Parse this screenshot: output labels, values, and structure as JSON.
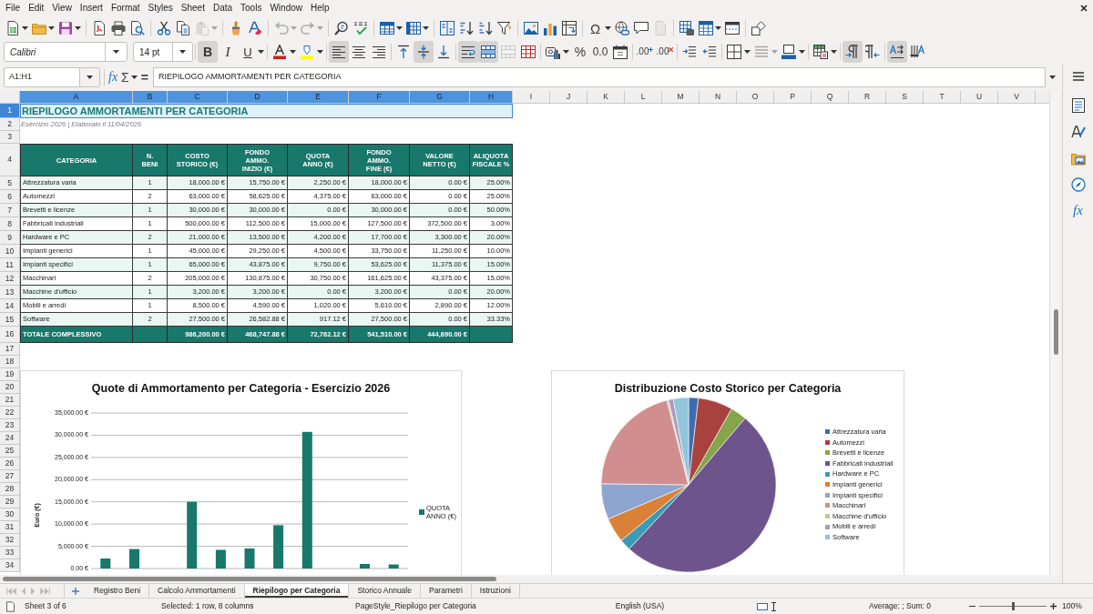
{
  "menu_bar": [
    "File",
    "Edit",
    "View",
    "Insert",
    "Format",
    "Styles",
    "Sheet",
    "Data",
    "Tools",
    "Window",
    "Help"
  ],
  "standard_toolbar": [
    {
      "kind": "icon",
      "dropdown": true,
      "disabled": false
    },
    {
      "kind": "icon",
      "dropdown": true,
      "disabled": false
    },
    {
      "kind": "icon",
      "dropdown": true,
      "disabled": false
    },
    {
      "kind": "separator"
    },
    {
      "kind": "icon",
      "dropdown": false,
      "disabled": false
    },
    {
      "kind": "icon",
      "dropdown": false,
      "disabled": false
    },
    {
      "kind": "icon",
      "dropdown": false,
      "disabled": false
    },
    {
      "kind": "separator"
    },
    {
      "kind": "icon",
      "dropdown": false,
      "disabled": false
    },
    {
      "kind": "icon",
      "dropdown": false,
      "disabled": false
    },
    {
      "kind": "icon",
      "dropdown": true,
      "disabled": true
    },
    {
      "kind": "separator"
    },
    {
      "kind": "icon",
      "dropdown": false,
      "disabled": false
    },
    {
      "kind": "icon",
      "dropdown": false,
      "disabled": false
    },
    {
      "kind": "separator"
    },
    {
      "kind": "icon",
      "dropdown": true,
      "disabled": true
    },
    {
      "kind": "icon",
      "dropdown": true,
      "disabled": true
    },
    {
      "kind": "separator"
    },
    {
      "kind": "icon",
      "dropdown": false,
      "disabled": false
    },
    {
      "kind": "icon",
      "dropdown": false,
      "disabled": false
    },
    {
      "kind": "separator"
    },
    {
      "kind": "icon",
      "dropdown": true,
      "disabled": false
    },
    {
      "kind": "icon",
      "dropdown": true,
      "disabled": false
    },
    {
      "kind": "separator"
    },
    {
      "kind": "icon",
      "dropdown": false,
      "disabled": false
    },
    {
      "kind": "icon",
      "dropdown": false,
      "disabled": false
    },
    {
      "kind": "icon",
      "dropdown": false,
      "disabled": false
    },
    {
      "kind": "icon",
      "dropdown": false,
      "disabled": false
    },
    {
      "kind": "separator"
    },
    {
      "kind": "icon",
      "dropdown": false,
      "disabled": false
    },
    {
      "kind": "icon",
      "dropdown": false,
      "disabled": false
    },
    {
      "kind": "icon",
      "dropdown": false,
      "disabled": false
    },
    {
      "kind": "separator"
    },
    {
      "kind": "glyph",
      "label": "Ω",
      "dropdown": true,
      "disabled": false
    },
    {
      "kind": "icon",
      "dropdown": false,
      "disabled": false
    },
    {
      "kind": "icon",
      "dropdown": false,
      "disabled": false
    },
    {
      "kind": "icon",
      "dropdown": false,
      "disabled": true
    },
    {
      "kind": "separator"
    },
    {
      "kind": "icon",
      "dropdown": false,
      "disabled": false
    },
    {
      "kind": "icon",
      "dropdown": true,
      "disabled": false
    },
    {
      "kind": "icon",
      "dropdown": false,
      "disabled": false
    },
    {
      "kind": "separator"
    },
    {
      "kind": "icon",
      "dropdown": false,
      "disabled": false
    }
  ],
  "formatting_toolbar": {
    "font_name": "Calibri",
    "font_size": "14 pt",
    "buttons": [
      {
        "kind": "separator"
      },
      {
        "kind": "glyph",
        "label": "B",
        "dropdown": false,
        "active": true,
        "disabled": false
      },
      {
        "kind": "glyph",
        "label": "I",
        "dropdown": false,
        "active": false,
        "disabled": false
      },
      {
        "kind": "glyph",
        "label": "U",
        "dropdown": true,
        "active": false,
        "disabled": false
      },
      {
        "kind": "separator"
      },
      {
        "kind": "icon",
        "dropdown": true,
        "active": false,
        "disabled": false
      },
      {
        "kind": "icon",
        "dropdown": true,
        "active": false,
        "disabled": false
      },
      {
        "kind": "separator"
      },
      {
        "kind": "icon",
        "dropdown": false,
        "active": true,
        "disabled": false
      },
      {
        "kind": "icon",
        "dropdown": false,
        "active": false,
        "disabled": false
      },
      {
        "kind": "icon",
        "dropdown": false,
        "active": false,
        "disabled": false
      },
      {
        "kind": "separator"
      },
      {
        "kind": "icon",
        "dropdown": false,
        "active": false,
        "disabled": false
      },
      {
        "kind": "icon",
        "dropdown": false,
        "active": true,
        "disabled": false
      },
      {
        "kind": "icon",
        "dropdown": false,
        "active": false,
        "disabled": false
      },
      {
        "kind": "separator"
      },
      {
        "kind": "icon",
        "dropdown": false,
        "active": true,
        "disabled": false
      },
      {
        "kind": "icon",
        "dropdown": false,
        "active": true,
        "disabled": false
      },
      {
        "kind": "icon",
        "dropdown": false,
        "active": false,
        "disabled": true
      },
      {
        "kind": "icon",
        "dropdown": false,
        "active": false,
        "disabled": false
      },
      {
        "kind": "separator"
      },
      {
        "kind": "icon",
        "dropdown": true,
        "active": false,
        "disabled": false
      },
      {
        "kind": "glyph",
        "label": "%",
        "dropdown": false,
        "active": false,
        "disabled": false
      },
      {
        "kind": "glyph",
        "label": "0.0",
        "dropdown": false,
        "active": false,
        "disabled": false
      },
      {
        "kind": "icon",
        "dropdown": false,
        "active": false,
        "disabled": false
      },
      {
        "kind": "separator"
      },
      {
        "kind": "glyph",
        "label": ".00",
        "dropdown": false,
        "active": false,
        "disabled": false
      },
      {
        "kind": "glyph",
        "label": ".00",
        "dropdown": false,
        "active": false,
        "disabled": false
      },
      {
        "kind": "separator"
      },
      {
        "kind": "icon",
        "dropdown": false,
        "active": false,
        "disabled": false
      },
      {
        "kind": "icon",
        "dropdown": false,
        "active": false,
        "disabled": false
      },
      {
        "kind": "separator"
      },
      {
        "kind": "icon",
        "dropdown": true,
        "active": false,
        "disabled": false
      },
      {
        "kind": "icon",
        "dropdown": true,
        "active": false,
        "disabled": true
      },
      {
        "kind": "icon",
        "dropdown": true,
        "active": false,
        "disabled": false
      },
      {
        "kind": "separator"
      },
      {
        "kind": "icon",
        "dropdown": true,
        "active": false,
        "disabled": false
      },
      {
        "kind": "separator"
      },
      {
        "kind": "icon",
        "dropdown": false,
        "active": true,
        "disabled": false
      },
      {
        "kind": "icon",
        "dropdown": false,
        "active": false,
        "disabled": false
      },
      {
        "kind": "separator"
      },
      {
        "kind": "icon",
        "dropdown": false,
        "active": true,
        "disabled": false
      },
      {
        "kind": "icon",
        "dropdown": false,
        "active": false,
        "disabled": false
      }
    ]
  },
  "formula_bar": {
    "name_box": "A1:H1",
    "buttons": [
      {
        "label": "fx",
        "dropdown": false
      },
      {
        "label": "Σ",
        "dropdown": true
      },
      {
        "label": "=",
        "dropdown": false
      }
    ],
    "content": "RIEPILOGO AMMORTAMENTI PER CATEGORIA"
  },
  "sidebar": {
    "tabs": [
      {
        "kind": "icon"
      },
      {
        "kind": "icon"
      },
      {
        "kind": "icon"
      },
      {
        "kind": "icon"
      },
      {
        "kind": "glyph",
        "label": "fx"
      }
    ]
  },
  "sheet": {
    "column_headers": [
      {
        "label": "A",
        "selected": true
      },
      {
        "label": "B",
        "selected": true
      },
      {
        "label": "C",
        "selected": true
      },
      {
        "label": "D",
        "selected": true
      },
      {
        "label": "E",
        "selected": true
      },
      {
        "label": "F",
        "selected": true
      },
      {
        "label": "G",
        "selected": true
      },
      {
        "label": "H",
        "selected": true
      },
      {
        "label": "I",
        "selected": false
      },
      {
        "label": "J",
        "selected": false
      },
      {
        "label": "K",
        "selected": false
      },
      {
        "label": "L",
        "selected": false
      },
      {
        "label": "M",
        "selected": false
      },
      {
        "label": "N",
        "selected": false
      },
      {
        "label": "O",
        "selected": false
      },
      {
        "label": "P",
        "selected": false
      },
      {
        "label": "Q",
        "selected": false
      },
      {
        "label": "R",
        "selected": false
      },
      {
        "label": "S",
        "selected": false
      },
      {
        "label": "T",
        "selected": false
      },
      {
        "label": "U",
        "selected": false
      },
      {
        "label": "V",
        "selected": false
      }
    ],
    "row_headers": [
      {
        "label": "1",
        "selected": true
      },
      {
        "label": "2",
        "selected": false
      },
      {
        "label": "3",
        "selected": false
      },
      {
        "label": "4",
        "selected": false
      },
      {
        "label": "5",
        "selected": false
      },
      {
        "label": "6",
        "selected": false
      },
      {
        "label": "7",
        "selected": false
      },
      {
        "label": "8",
        "selected": false
      },
      {
        "label": "9",
        "selected": false
      },
      {
        "label": "10",
        "selected": false
      },
      {
        "label": "11",
        "selected": false
      },
      {
        "label": "12",
        "selected": false
      },
      {
        "label": "13",
        "selected": false
      },
      {
        "label": "14",
        "selected": false
      },
      {
        "label": "15",
        "selected": false
      },
      {
        "label": "16",
        "selected": false
      },
      {
        "label": "17",
        "selected": false
      },
      {
        "label": "18",
        "selected": false
      },
      {
        "label": "19",
        "selected": false
      },
      {
        "label": "20",
        "selected": false
      },
      {
        "label": "21",
        "selected": false
      },
      {
        "label": "22",
        "selected": false
      },
      {
        "label": "23",
        "selected": false
      },
      {
        "label": "24",
        "selected": false
      },
      {
        "label": "25",
        "selected": false
      },
      {
        "label": "26",
        "selected": false
      },
      {
        "label": "27",
        "selected": false
      },
      {
        "label": "28",
        "selected": false
      },
      {
        "label": "29",
        "selected": false
      },
      {
        "label": "30",
        "selected": false
      },
      {
        "label": "31",
        "selected": false
      },
      {
        "label": "32",
        "selected": false
      },
      {
        "label": "33",
        "selected": false
      },
      {
        "label": "34",
        "selected": false
      }
    ],
    "title": {
      "text": "RIEPILOGO AMMORTAMENTI PER CATEGORIA",
      "selected": true
    },
    "subtitle": "Esercizio 2026 | Elaborato il 11/04/2026",
    "table": {
      "columns": [
        "CATEGORIA",
        "N.\nBENI",
        "COSTO\nSTORICO (€)",
        "FONDO\nAMMO.\nINIZIO (€)",
        "QUOTA\nANNO (€)",
        "FONDO\nAMMO.\nFINE (€)",
        "VALORE\nNETTO (€)",
        "ALIQUOTA\nFISCALE %"
      ],
      "rows": [
        [
          "Attrezzatura varia",
          "1",
          "18,000.00 €",
          "15,750.00 €",
          "2,250.00 €",
          "18,000.00 €",
          "0.00 €",
          "25.00%"
        ],
        [
          "Automezzi",
          "2",
          "63,000.00 €",
          "58,625.00 €",
          "4,375.00 €",
          "63,000.00 €",
          "0.00 €",
          "25.00%"
        ],
        [
          "Brevetti e licenze",
          "1",
          "30,000.00 €",
          "30,000.00 €",
          "0.00 €",
          "30,000.00 €",
          "0.00 €",
          "50.00%"
        ],
        [
          "Fabbricati industriali",
          "1",
          "500,000.00 €",
          "112,500.00 €",
          "15,000.00 €",
          "127,500.00 €",
          "372,500.00 €",
          "3.00%"
        ],
        [
          "Hardware e PC",
          "2",
          "21,000.00 €",
          "13,500.00 €",
          "4,200.00 €",
          "17,700.00 €",
          "3,300.00 €",
          "20.00%"
        ],
        [
          "Impianti generici",
          "1",
          "45,000.00 €",
          "29,250.00 €",
          "4,500.00 €",
          "33,750.00 €",
          "11,250.00 €",
          "10.00%"
        ],
        [
          "Impianti specifici",
          "1",
          "65,000.00 €",
          "43,875.00 €",
          "9,750.00 €",
          "53,625.00 €",
          "11,375.00 €",
          "15.00%"
        ],
        [
          "Macchinari",
          "2",
          "205,000.00 €",
          "130,875.00 €",
          "30,750.00 €",
          "161,625.00 €",
          "43,375.00 €",
          "15.00%"
        ],
        [
          "Macchine d'ufficio",
          "1",
          "3,200.00 €",
          "3,200.00 €",
          "0.00 €",
          "3,200.00 €",
          "0.00 €",
          "20.00%"
        ],
        [
          "Mobili e arredi",
          "1",
          "8,500.00 €",
          "4,590.00 €",
          "1,020.00 €",
          "5,610.00 €",
          "2,890.00 €",
          "12.00%"
        ],
        [
          "Software",
          "2",
          "27,500.00 €",
          "26,582.88 €",
          "917.12 €",
          "27,500.00 €",
          "0.00 €",
          "33.33%"
        ]
      ],
      "total_row": {
        "label": "TOTALE COMPLESSIVO",
        "values": [
          "986,200.00 €",
          "468,747.88 €",
          "72,762.12 €",
          "541,510.00 €",
          "444,690.00 €"
        ]
      }
    }
  },
  "charts": [
    {
      "chart_data": {
        "type": "bar",
        "title": "Quote di Ammortamento per Categoria - Esercizio 2026",
        "ylabel": "Euro (€)",
        "series": [
          {
            "name": "QUOTA ANNO (€)",
            "color": "#17786b",
            "values": [
              2250,
              4375,
              0,
              15000,
              4200,
              4500,
              9750,
              30750,
              0,
              1020,
              917.12
            ]
          }
        ],
        "ylim": [
          0,
          35000
        ],
        "yticks": [
          {
            "value": 0,
            "label": "0.00 €"
          },
          {
            "value": 5000,
            "label": "5,000.00 €"
          },
          {
            "value": 10000,
            "label": "10,000.00 €"
          },
          {
            "value": 15000,
            "label": "15,000.00 €"
          },
          {
            "value": 20000,
            "label": "20,000.00 €"
          },
          {
            "value": 25000,
            "label": "25,000.00 €"
          },
          {
            "value": 30000,
            "label": "30,000.00 €"
          },
          {
            "value": 35000,
            "label": "35,000.00 €"
          }
        ],
        "grid": true,
        "legend": "right"
      }
    },
    {
      "chart_data": {
        "type": "pie",
        "title": "Distribuzione Costo Storico per Categoria",
        "categories": [
          "Attrezzatura varia",
          "Automezzi",
          "Brevetti e licenze",
          "Fabbricati industriali",
          "Hardware e PC",
          "Impianti generici",
          "Impianti specifici",
          "Macchinari",
          "Macchine d'ufficio",
          "Mobili e arredi",
          "Software"
        ],
        "values": [
          1.8,
          6.4,
          3.0,
          50.7,
          2.1,
          4.6,
          6.6,
          20.8,
          0.3,
          0.9,
          2.8
        ],
        "colors": [
          "#3f6cae",
          "#a8423f",
          "#86a44a",
          "#6e548d",
          "#3c9ab4",
          "#da8137",
          "#8ea5cf",
          "#d08f8e",
          "#b7cd95",
          "#a99bbd",
          "#92c5da"
        ],
        "legend": "right"
      }
    }
  ],
  "sheet_tabs": {
    "navigation": [
      {
        "disabled": true
      },
      {
        "disabled": true
      },
      {
        "disabled": true
      },
      {
        "disabled": true
      }
    ],
    "tabs": [
      {
        "label": "Registro Beni",
        "selected": false
      },
      {
        "label": "Calcolo Ammortamenti",
        "selected": false
      },
      {
        "label": "Riepilogo per Categoria",
        "selected": true
      },
      {
        "label": "Storico Annuale",
        "selected": false
      },
      {
        "label": "Parametri",
        "selected": false
      },
      {
        "label": "Istruzioni",
        "selected": false
      }
    ]
  },
  "status_bar": {
    "sheet": "Sheet 3 of 6",
    "selection": "Selected: 1 row, 8 columns",
    "page_style": "PageStyle_Riepilogo per Categoria",
    "language": "English (USA)",
    "statistics": "Average: ; Sum: 0",
    "zoom": {
      "level": 0.5,
      "value": "100%"
    }
  }
}
